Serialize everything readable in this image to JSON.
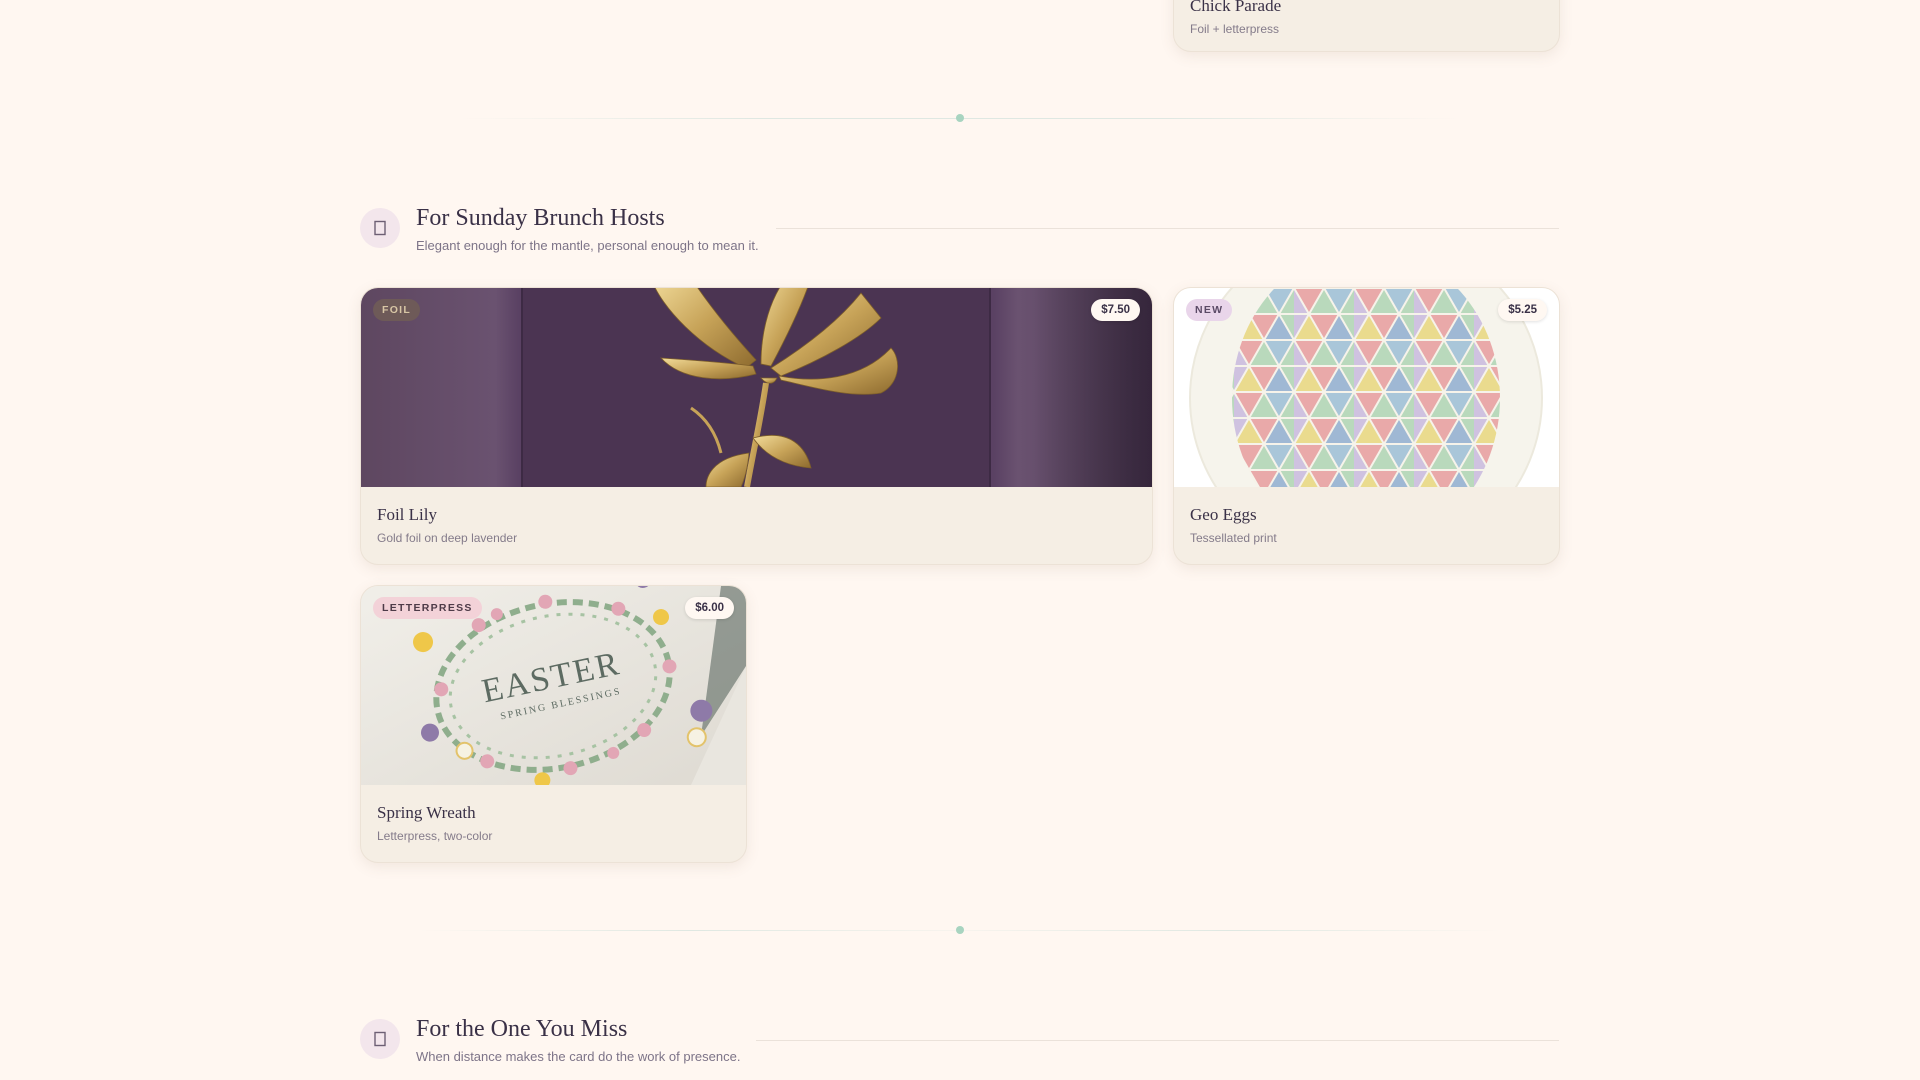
{
  "top_card": {
    "title": "Chick Parade",
    "subtitle": "Foil + letterpress"
  },
  "sections": [
    {
      "title": "For Sunday Brunch Hosts",
      "subtitle": "Elegant enough for the mantle, personal enough to mean it.",
      "icon": "bookmark-icon",
      "cards": [
        {
          "title": "Foil Lily",
          "subtitle": "Gold foil on deep lavender",
          "badge": "FOIL",
          "price": "$7.50"
        },
        {
          "title": "Geo Eggs",
          "subtitle": "Tessellated print",
          "badge": "NEW",
          "price": "$5.25"
        },
        {
          "title": "Spring Wreath",
          "subtitle": "Letterpress, two-color",
          "badge": "LETTERPRESS",
          "price": "$6.00"
        }
      ]
    },
    {
      "title": "For the One You Miss",
      "subtitle": "When distance makes the card do the work of presence.",
      "icon": "bookmark-icon"
    }
  ],
  "wreath_art": {
    "headline": "EASTER",
    "subline": "SPRING BLESSINGS"
  },
  "colors": {
    "page_bg": "#fff7f1",
    "card_bg": "#f5eee4",
    "accent_mint": "#a8d4c0",
    "foil_badge": "#6e5a58",
    "new_badge": "#e9d5ea",
    "letterpress_badge": "#f3d2d8"
  }
}
